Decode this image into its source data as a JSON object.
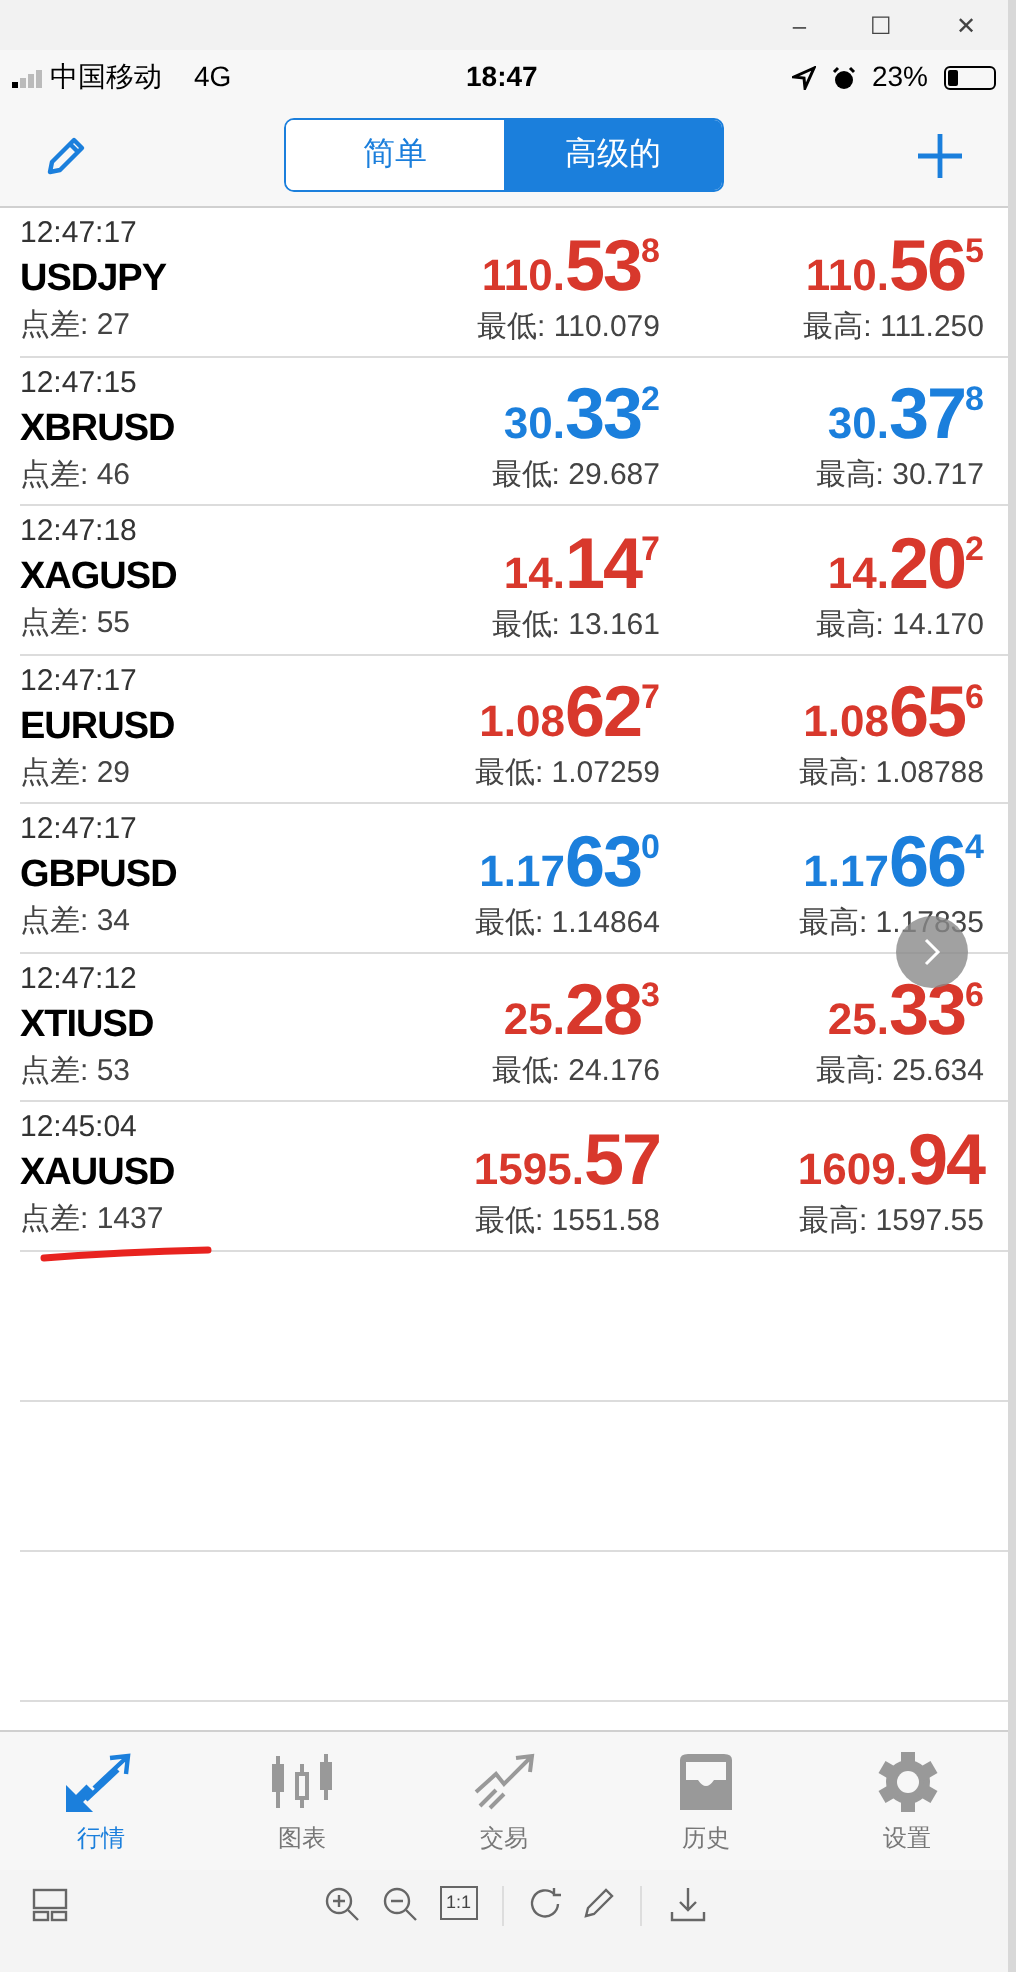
{
  "window": {
    "controls": [
      "–",
      "☐",
      "✕"
    ]
  },
  "status_bar": {
    "carrier": "中国移动",
    "network": "4G",
    "time": "18:47",
    "battery": "23%"
  },
  "segmented": [
    {
      "label": "简单",
      "selected": false
    },
    {
      "label": "高级的",
      "selected": true
    }
  ],
  "quotes": [
    {
      "time": "12:47:17",
      "symbol": "USDJPY",
      "spread": "点差: 27",
      "color": "#d8382c",
      "bid": {
        "prefix": "110.",
        "big": "53",
        "sup": "8"
      },
      "ask": {
        "prefix": "110.",
        "big": "56",
        "sup": "5"
      },
      "low": "最低: 110.079",
      "high": "最高: 111.250",
      "underlined": false
    },
    {
      "time": "12:47:15",
      "symbol": "XBRUSD",
      "spread": "点差: 46",
      "color": "#1b7fdc",
      "bid": {
        "prefix": "30.",
        "big": "33",
        "sup": "2"
      },
      "ask": {
        "prefix": "30.",
        "big": "37",
        "sup": "8"
      },
      "low": "最低: 29.687",
      "high": "最高: 30.717",
      "underlined": false
    },
    {
      "time": "12:47:18",
      "symbol": "XAGUSD",
      "spread": "点差: 55",
      "color": "#d8382c",
      "bid": {
        "prefix": "14.",
        "big": "14",
        "sup": "7"
      },
      "ask": {
        "prefix": "14.",
        "big": "20",
        "sup": "2"
      },
      "low": "最低: 13.161",
      "high": "最高: 14.170",
      "underlined": false
    },
    {
      "time": "12:47:17",
      "symbol": "EURUSD",
      "spread": "点差: 29",
      "color": "#d8382c",
      "bid": {
        "prefix": "1.08",
        "big": "62",
        "sup": "7"
      },
      "ask": {
        "prefix": "1.08",
        "big": "65",
        "sup": "6"
      },
      "low": "最低: 1.07259",
      "high": "最高: 1.08788",
      "underlined": false
    },
    {
      "time": "12:47:17",
      "symbol": "GBPUSD",
      "spread": "点差: 34",
      "color": "#1b7fdc",
      "bid": {
        "prefix": "1.17",
        "big": "63",
        "sup": "0"
      },
      "ask": {
        "prefix": "1.17",
        "big": "66",
        "sup": "4"
      },
      "low": "最低: 1.14864",
      "high": "最高: 1.17835",
      "underlined": false
    },
    {
      "time": "12:47:12",
      "symbol": "XTIUSD",
      "spread": "点差: 53",
      "color": "#d8382c",
      "bid": {
        "prefix": "25.",
        "big": "28",
        "sup": "3"
      },
      "ask": {
        "prefix": "25.",
        "big": "33",
        "sup": "6"
      },
      "low": "最低: 24.176",
      "high": "最高: 25.634",
      "underlined": false
    },
    {
      "time": "12:45:04",
      "symbol": "XAUUSD",
      "spread": "点差: 1437",
      "color": "#d8382c",
      "bid": {
        "prefix": "1595.",
        "big": "57"
      },
      "ask": {
        "prefix": "1609.",
        "big": "94"
      },
      "low": "最低: 1551.58",
      "high": "最高: 1597.55",
      "underlined": true
    }
  ],
  "tabs": [
    {
      "label": "行情",
      "selected": true,
      "kind": "quotes"
    },
    {
      "label": "图表",
      "selected": false,
      "kind": "chart"
    },
    {
      "label": "交易",
      "selected": false,
      "kind": "trade"
    },
    {
      "label": "历史",
      "selected": false,
      "kind": "history"
    },
    {
      "label": "设置",
      "selected": false,
      "kind": "settings"
    }
  ],
  "viewer_toolbar": {
    "zoom_reset": "1:1"
  }
}
